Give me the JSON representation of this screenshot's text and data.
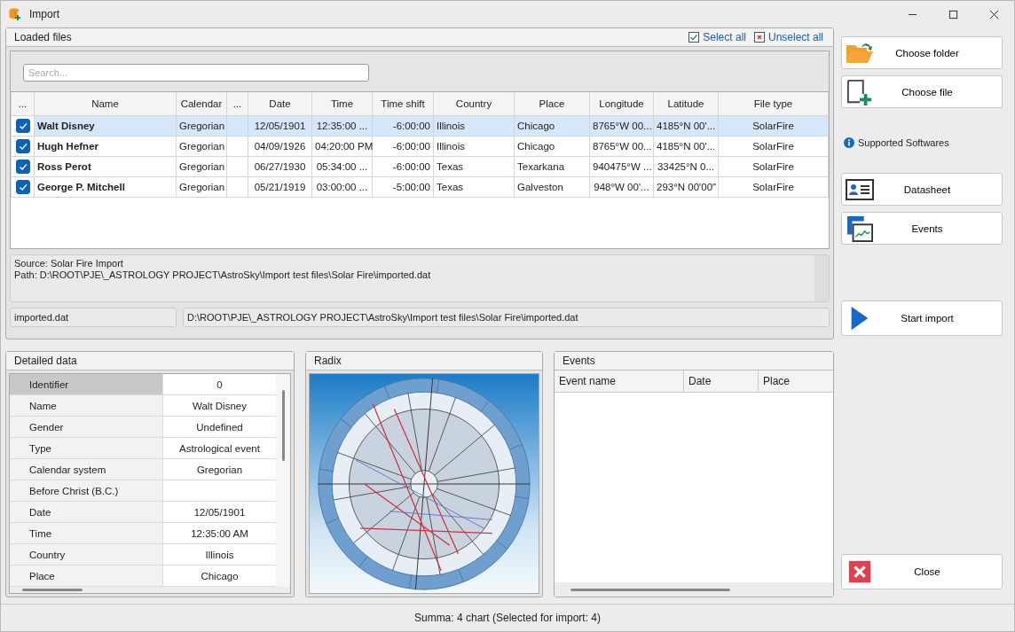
{
  "window": {
    "title": "Import"
  },
  "loaded_files": {
    "title": "Loaded files",
    "select_all": "Select all",
    "unselect_all": "Unselect all",
    "search": {
      "placeholder": "Search..."
    },
    "table": {
      "columns": [
        {
          "label": "...",
          "kind": "check"
        },
        {
          "label": "Name",
          "kind": "name"
        },
        {
          "label": "Calendar",
          "kind": "calendar"
        },
        {
          "label": "...",
          "kind": "blank"
        },
        {
          "label": "Date",
          "kind": "date"
        },
        {
          "label": "Time",
          "kind": "time"
        },
        {
          "label": "Time shift",
          "kind": "time_shift"
        },
        {
          "label": "Country",
          "kind": "country"
        },
        {
          "label": "Place",
          "kind": "place"
        },
        {
          "label": "Longitude",
          "kind": "longitude"
        },
        {
          "label": "Latitude",
          "kind": "latitude"
        },
        {
          "label": "File type",
          "kind": "file_type"
        }
      ],
      "rows": [
        {
          "checked": true,
          "selected": true,
          "name": "Walt Disney",
          "calendar": "Gregorian",
          "date": "12/05/1901",
          "time": "12:35:00 ...",
          "time_shift": "-6:00:00",
          "country": "Illinois",
          "place": "Chicago",
          "longitude": "8765°W 00...",
          "latitude": "4185°N 00'...",
          "file_type": "SolarFire"
        },
        {
          "checked": true,
          "selected": false,
          "name": "Hugh Hefner",
          "calendar": "Gregorian",
          "date": "04/09/1926",
          "time": "04:20:00 PM",
          "time_shift": "-6:00:00",
          "country": "Illinois",
          "place": "Chicago",
          "longitude": "8765°W 00...",
          "latitude": "4185°N 00'...",
          "file_type": "SolarFire"
        },
        {
          "checked": true,
          "selected": false,
          "name": "Ross Perot",
          "calendar": "Gregorian",
          "date": "06/27/1930",
          "time": "05:34:00 ...",
          "time_shift": "-6:00:00",
          "country": "Texas",
          "place": "Texarkana",
          "longitude": "940475°W ...",
          "latitude": "33425°N 0...",
          "file_type": "SolarFire"
        },
        {
          "checked": true,
          "selected": false,
          "name": "George P. Mitchell",
          "calendar": "Gregorian",
          "date": "05/21/1919",
          "time": "03:00:00 ...",
          "time_shift": "-5:00:00",
          "country": "Texas",
          "place": "Galveston",
          "longitude": "948°W 00'...",
          "latitude": "293°N 00'00\"",
          "file_type": "SolarFire"
        }
      ]
    },
    "source_info": [
      "Source: Solar Fire Import",
      "Path: D:\\ROOT\\PJE\\_ASTROLOGY PROJECT\\AstroSky\\Import test files\\Solar Fire\\imported.dat"
    ],
    "file_name": "imported.dat",
    "file_path": "D:\\ROOT\\PJE\\_ASTROLOGY PROJECT\\AstroSky\\Import test files\\Solar Fire\\imported.dat"
  },
  "detailed_data": {
    "title": "Detailed data",
    "rows": [
      {
        "label": "Identifier",
        "value": "0",
        "selected": true
      },
      {
        "label": "Name",
        "value": "Walt Disney",
        "selected": false
      },
      {
        "label": "Gender",
        "value": "Undefined",
        "selected": false
      },
      {
        "label": "Type",
        "value": "Astrological event",
        "selected": false
      },
      {
        "label": "Calendar system",
        "value": "Gregorian",
        "selected": false
      },
      {
        "label": "Before Christ (B.C.)",
        "selected": false
      },
      {
        "label": "Date",
        "value": "12/05/1901",
        "selected": false
      },
      {
        "label": "Time",
        "value": "12:35:00 AM",
        "selected": false
      },
      {
        "label": "Country",
        "value": "Illinois",
        "selected": false
      },
      {
        "label": "Place",
        "value": "Chicago",
        "selected": false
      }
    ]
  },
  "radix": {
    "title": "Radix"
  },
  "events": {
    "title": "Events",
    "columns": [
      "Event name",
      "Date",
      "Place"
    ]
  },
  "actions": [
    {
      "kind": "folder",
      "label": "Choose folder"
    },
    {
      "kind": "file",
      "label": "Choose file"
    },
    {
      "kind": "info",
      "label": "Supported Softwares"
    },
    {
      "kind": "datasheet",
      "label": "Datasheet"
    },
    {
      "kind": "events",
      "label": "Events"
    },
    {
      "kind": "start",
      "label": "Start import"
    },
    {
      "kind": "close",
      "label": "Close"
    }
  ],
  "status_bar": "Summa: 4 chart (Selected for import: 4)"
}
